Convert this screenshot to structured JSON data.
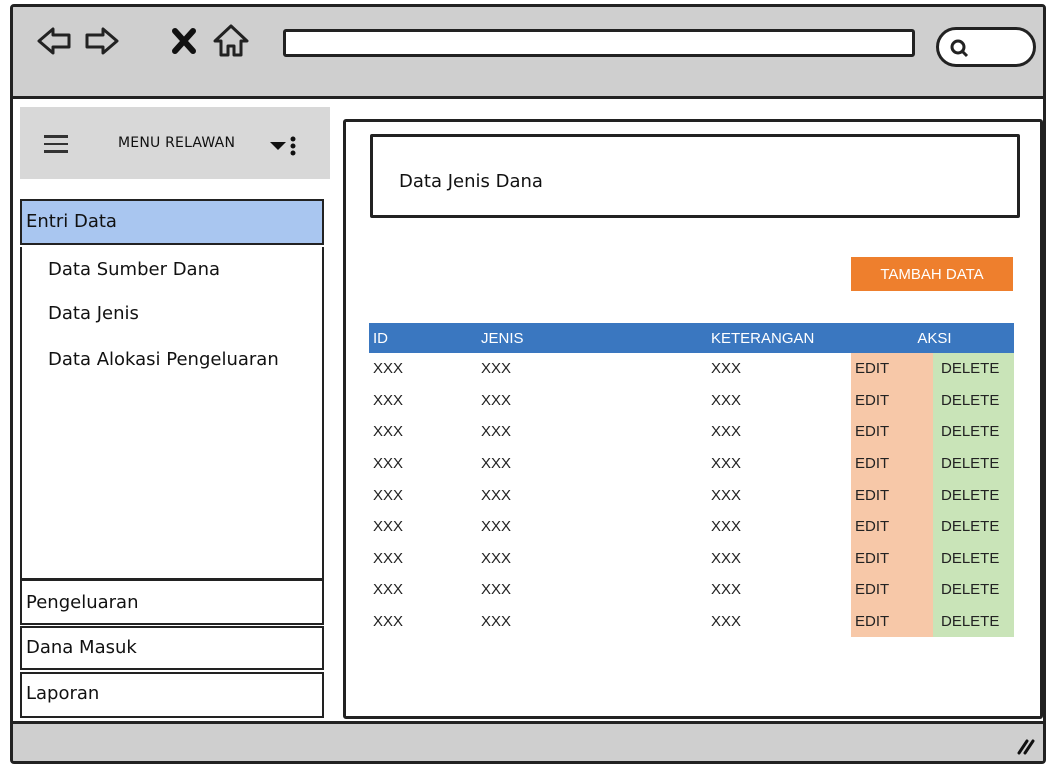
{
  "browser": {
    "nav_icons": [
      "back-arrow-icon",
      "forward-arrow-icon",
      "close-icon",
      "home-icon"
    ],
    "search_icon": "search-icon"
  },
  "sidebar": {
    "menu_title": "MENU RELAWAN",
    "active_item": "Entri Data",
    "sub_items": [
      "Data Sumber Dana",
      "Data Jenis",
      "Data Alokasi Pengeluaran"
    ],
    "items": [
      "Pengeluaran",
      "Dana Masuk",
      "Laporan"
    ]
  },
  "main": {
    "title": "Data Jenis Dana",
    "add_button": "TAMBAH DATA",
    "table": {
      "headers": [
        "ID",
        "JENIS",
        "KETERANGAN",
        "AKSI"
      ],
      "edit_label": "EDIT",
      "delete_label": "DELETE",
      "rows": [
        [
          "XXX",
          "XXX",
          "XXX"
        ],
        [
          "XXX",
          "XXX",
          "XXX"
        ],
        [
          "XXX",
          "XXX",
          "XXX"
        ],
        [
          "XXX",
          "XXX",
          "XXX"
        ],
        [
          "XXX",
          "XXX",
          "XXX"
        ],
        [
          "XXX",
          "XXX",
          "XXX"
        ],
        [
          "XXX",
          "XXX",
          "XXX"
        ],
        [
          "XXX",
          "XXX",
          "XXX"
        ],
        [
          "XXX",
          "XXX",
          "XXX"
        ]
      ]
    }
  },
  "colors": {
    "active_menu": "#a9c6f0",
    "add_button": "#ee7f2d",
    "table_header": "#3a77c0",
    "edit_cell": "#f7c8a8",
    "delete_cell": "#c9e4b8",
    "chrome": "#cfcfcf"
  }
}
